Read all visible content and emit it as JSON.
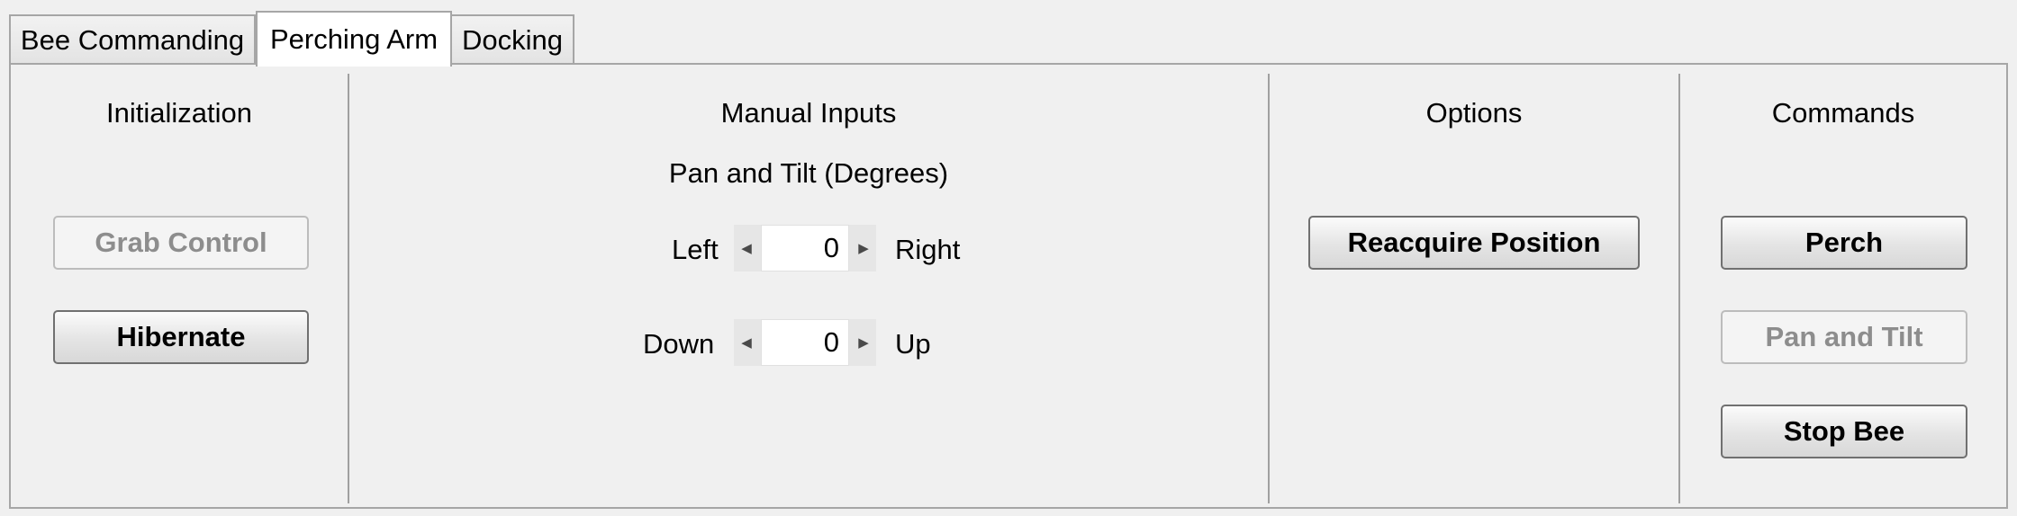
{
  "tabs": [
    {
      "label": "Bee Commanding",
      "active": false
    },
    {
      "label": "Perching Arm",
      "active": true
    },
    {
      "label": "Docking",
      "active": false
    }
  ],
  "initialization": {
    "title": "Initialization",
    "grab_control": {
      "label": "Grab Control",
      "enabled": false
    },
    "hibernate": {
      "label": "Hibernate",
      "enabled": true
    }
  },
  "manual_inputs": {
    "title": "Manual Inputs",
    "subtitle": "Pan and Tilt (Degrees)",
    "pan": {
      "left_label": "Left",
      "right_label": "Right",
      "value": "0"
    },
    "tilt": {
      "left_label": "Down",
      "right_label": "Up",
      "value": "0"
    },
    "arrow_icons": {
      "decrement": "arrow-left-icon",
      "increment": "arrow-right-icon"
    }
  },
  "options": {
    "title": "Options",
    "reacquire_position": {
      "label": "Reacquire Position",
      "enabled": true
    }
  },
  "commands": {
    "title": "Commands",
    "perch": {
      "label": "Perch",
      "enabled": true
    },
    "pan_and_tilt": {
      "label": "Pan and Tilt",
      "enabled": false
    },
    "stop_bee": {
      "label": "Stop Bee",
      "enabled": true
    }
  },
  "colors": {
    "background": "#f0f0f0",
    "border": "#a6a6a6",
    "disabled_text": "#8d8d8d"
  }
}
